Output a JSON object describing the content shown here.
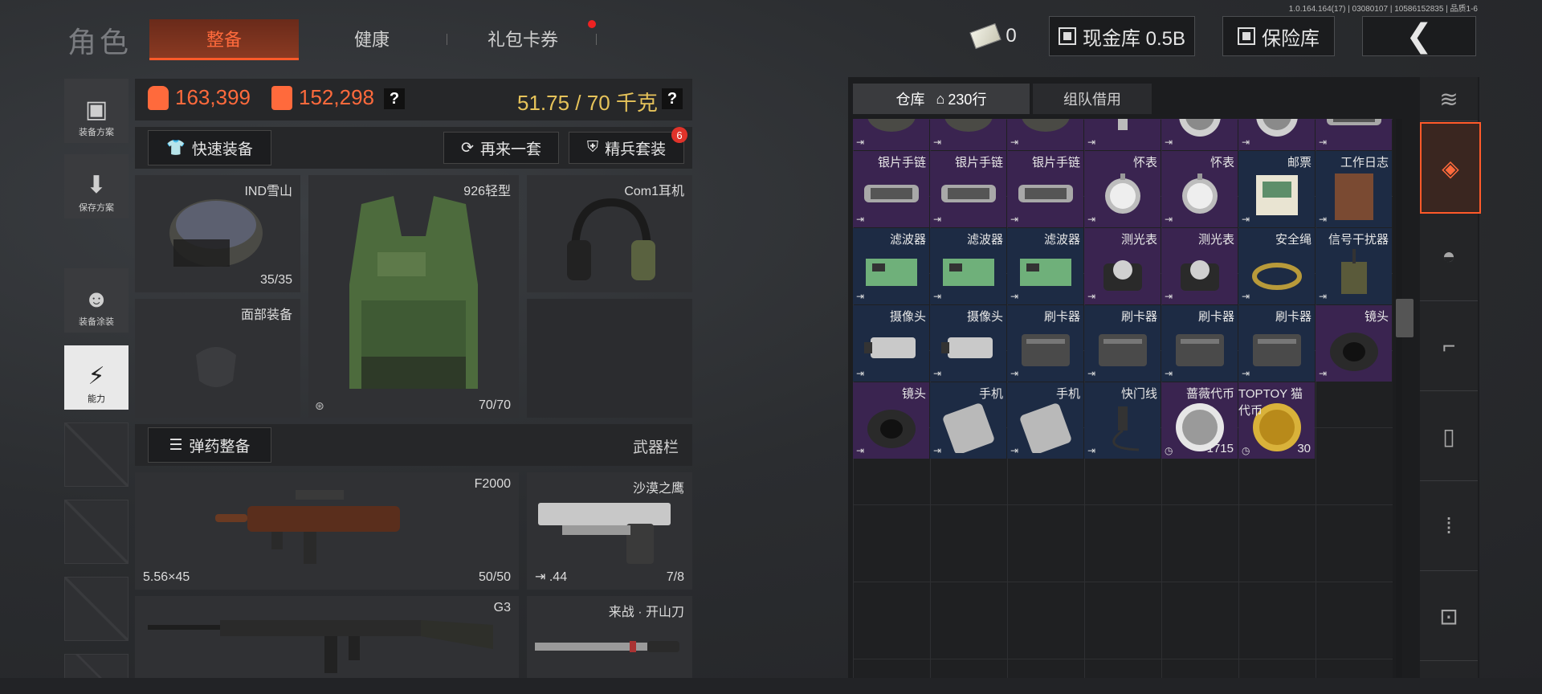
{
  "version": "1.0.164.164(17) | 03080107 | 10586152835 | 品质1-6",
  "page_title": "角色",
  "tabs": [
    {
      "label": "整备"
    },
    {
      "label": "健康"
    },
    {
      "label": "礼包卡券"
    }
  ],
  "currency": {
    "cash_count": "0",
    "cash_vault": "现金库 0.5B",
    "safe": "保险库"
  },
  "side_buttons": [
    "装备方案",
    "保存方案",
    "装备涂装",
    "能力"
  ],
  "stats": {
    "value1": "163,399",
    "value2": "152,298",
    "weight": "51.75 / 70 千克",
    "help": "?"
  },
  "actions": {
    "quick_equip": "快速装备",
    "again": "再来一套",
    "elite": "精兵套装",
    "elite_badge": "6"
  },
  "slots": {
    "helmet": {
      "name": "IND雪山",
      "dur": "35/35"
    },
    "vest": {
      "name": "926轻型",
      "dur": "70/70"
    },
    "headset": {
      "name": "Com1耳机"
    },
    "face": {
      "name": "面部装备"
    }
  },
  "ammo": {
    "button": "弹药整备",
    "weapon_bar": "武器栏"
  },
  "weapons": {
    "primary": {
      "name": "F2000",
      "caliber": "5.56×45",
      "ammo": "50/50"
    },
    "pistol": {
      "name": "沙漠之鹰",
      "caliber": ".44",
      "ammo": "7/8"
    },
    "secondary": {
      "name": "G3"
    },
    "melee": {
      "name": "来战 · 开山刀"
    }
  },
  "warehouse": {
    "tab1": "仓库",
    "rows": "230行",
    "tab2": "组队借用"
  },
  "items": [
    {
      "name": "",
      "rarity": "purple",
      "art": "helmet"
    },
    {
      "name": "",
      "rarity": "purple",
      "art": "helmet"
    },
    {
      "name": "",
      "rarity": "purple",
      "art": "helmet"
    },
    {
      "name": "",
      "rarity": "purple",
      "art": "tube"
    },
    {
      "name": "",
      "rarity": "purple",
      "art": "coin"
    },
    {
      "name": "",
      "rarity": "purple",
      "art": "coin"
    },
    {
      "name": "",
      "rarity": "purple",
      "art": "chain"
    },
    {
      "name": "银片手链",
      "rarity": "purple",
      "art": "chain"
    },
    {
      "name": "银片手链",
      "rarity": "purple",
      "art": "chain"
    },
    {
      "name": "银片手链",
      "rarity": "purple",
      "art": "chain"
    },
    {
      "name": "怀表",
      "rarity": "purple",
      "art": "watch"
    },
    {
      "name": "怀表",
      "rarity": "purple",
      "art": "watch"
    },
    {
      "name": "邮票",
      "rarity": "blue",
      "art": "stamp"
    },
    {
      "name": "工作日志",
      "rarity": "blue",
      "art": "book"
    },
    {
      "name": "滤波器",
      "rarity": "blue",
      "art": "board"
    },
    {
      "name": "滤波器",
      "rarity": "blue",
      "art": "board"
    },
    {
      "name": "滤波器",
      "rarity": "blue",
      "art": "board"
    },
    {
      "name": "测光表",
      "rarity": "purple",
      "art": "meter"
    },
    {
      "name": "测光表",
      "rarity": "purple",
      "art": "meter"
    },
    {
      "name": "安全绳",
      "rarity": "blue",
      "art": "rope"
    },
    {
      "name": "信号干扰器",
      "rarity": "blue",
      "art": "jammer"
    },
    {
      "name": "摄像头",
      "rarity": "blue",
      "art": "camera"
    },
    {
      "name": "摄像头",
      "rarity": "blue",
      "art": "camera"
    },
    {
      "name": "刷卡器",
      "rarity": "blue",
      "art": "reader"
    },
    {
      "name": "刷卡器",
      "rarity": "blue",
      "art": "reader"
    },
    {
      "name": "刷卡器",
      "rarity": "blue",
      "art": "reader"
    },
    {
      "name": "刷卡器",
      "rarity": "blue",
      "art": "reader"
    },
    {
      "name": "镜头",
      "rarity": "purple",
      "art": "lens"
    },
    {
      "name": "镜头",
      "rarity": "purple",
      "art": "lens"
    },
    {
      "name": "手机",
      "rarity": "blue",
      "art": "phone"
    },
    {
      "name": "手机",
      "rarity": "blue",
      "art": "phone"
    },
    {
      "name": "快门线",
      "rarity": "blue",
      "art": "cable"
    },
    {
      "name": "蔷薇代币",
      "rarity": "purple",
      "art": "silvercoin",
      "count": "1715"
    },
    {
      "name": "TOPTOY 猫代币",
      "rarity": "purple",
      "art": "goldcoin",
      "count": "30"
    }
  ],
  "categories": [
    "layers-icon",
    "stack-icon",
    "helmet-icon",
    "rifle-icon",
    "magazine-icon",
    "bullet-icon",
    "sight-icon"
  ]
}
